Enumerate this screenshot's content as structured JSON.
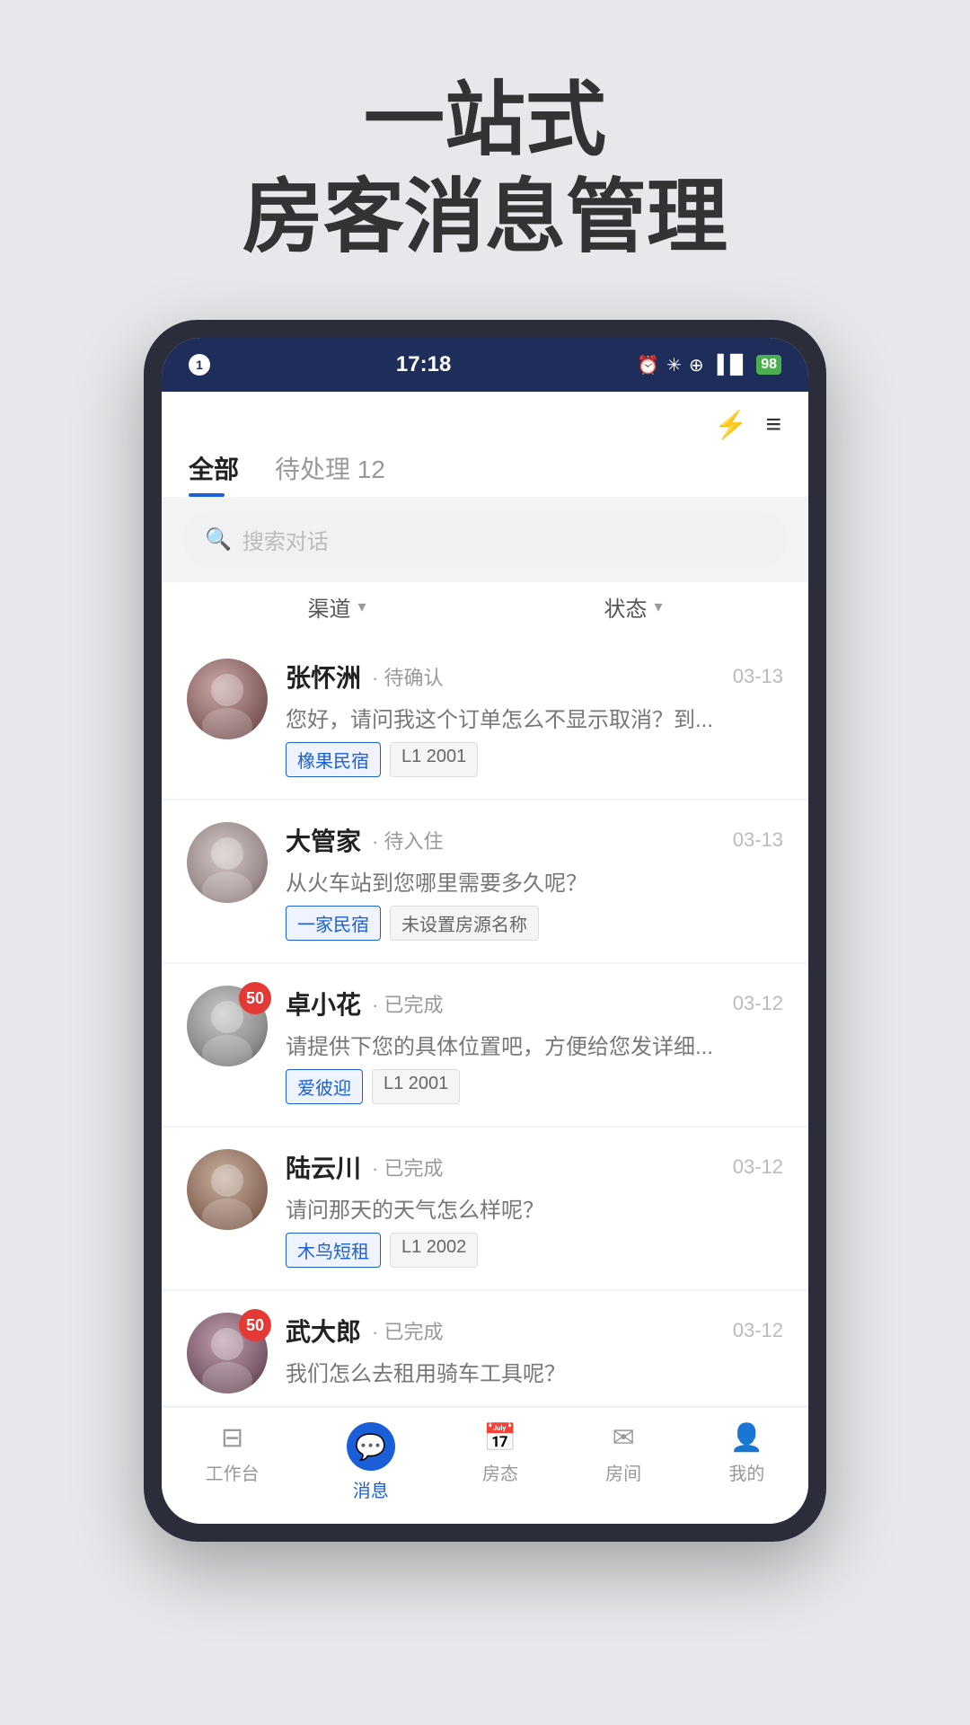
{
  "header": {
    "title_line1": "一站式",
    "title_line2": "房客消息管理"
  },
  "status_bar": {
    "badge": "1",
    "time": "17:18",
    "icons": "⏰ ✳ ⊕ ▐▐▐",
    "battery": "98"
  },
  "app_header": {
    "lightning_icon": "⚡",
    "menu_icon": "≡",
    "tab_all": "全部",
    "tab_pending": "待处理 12",
    "search_placeholder": "搜索对话"
  },
  "filters": {
    "channel_label": "渠道",
    "status_label": "状态"
  },
  "conversations": [
    {
      "name": "张怀洲",
      "status": "· 待确认",
      "date": "03-13",
      "preview": "您好，请问我这个订单怎么不显示取消？到...",
      "tag1": "橡果民宿",
      "tag2": "L1 2001",
      "tag1_type": "blue",
      "tag2_type": "gray",
      "avatar_class": "avatar-1",
      "unread": ""
    },
    {
      "name": "大管家",
      "status": "· 待入住",
      "date": "03-13",
      "preview": "从火车站到您哪里需要多久呢？",
      "tag1": "一家民宿",
      "tag2": "未设置房源名称",
      "tag1_type": "blue",
      "tag2_type": "gray",
      "avatar_class": "avatar-2",
      "unread": ""
    },
    {
      "name": "卓小花",
      "status": "· 已完成",
      "date": "03-12",
      "preview": "请提供下您的具体位置吧，方便给您发详细...",
      "tag1": "爱彼迎",
      "tag2": "L1 2001",
      "tag1_type": "blue",
      "tag2_type": "gray",
      "avatar_class": "avatar-3",
      "unread": "50"
    },
    {
      "name": "陆云川",
      "status": "· 已完成",
      "date": "03-12",
      "preview": "请问那天的天气怎么样呢？",
      "tag1": "木鸟短租",
      "tag2": "L1 2002",
      "tag1_type": "blue",
      "tag2_type": "gray",
      "avatar_class": "avatar-4",
      "unread": ""
    },
    {
      "name": "武大郎",
      "status": "· 已完成",
      "date": "03-12",
      "preview": "我们怎么去租用骑车工具呢？",
      "tag1": "",
      "tag2": "",
      "tag1_type": "",
      "tag2_type": "",
      "avatar_class": "avatar-5",
      "unread": "50"
    }
  ],
  "bottom_nav": [
    {
      "label": "工作台",
      "icon": "⊟",
      "active": false
    },
    {
      "label": "消息",
      "icon": "💬",
      "active": true
    },
    {
      "label": "房态",
      "icon": "📅",
      "active": false
    },
    {
      "label": "房间",
      "icon": "✉",
      "active": false
    },
    {
      "label": "我的",
      "icon": "👤",
      "active": false
    }
  ]
}
